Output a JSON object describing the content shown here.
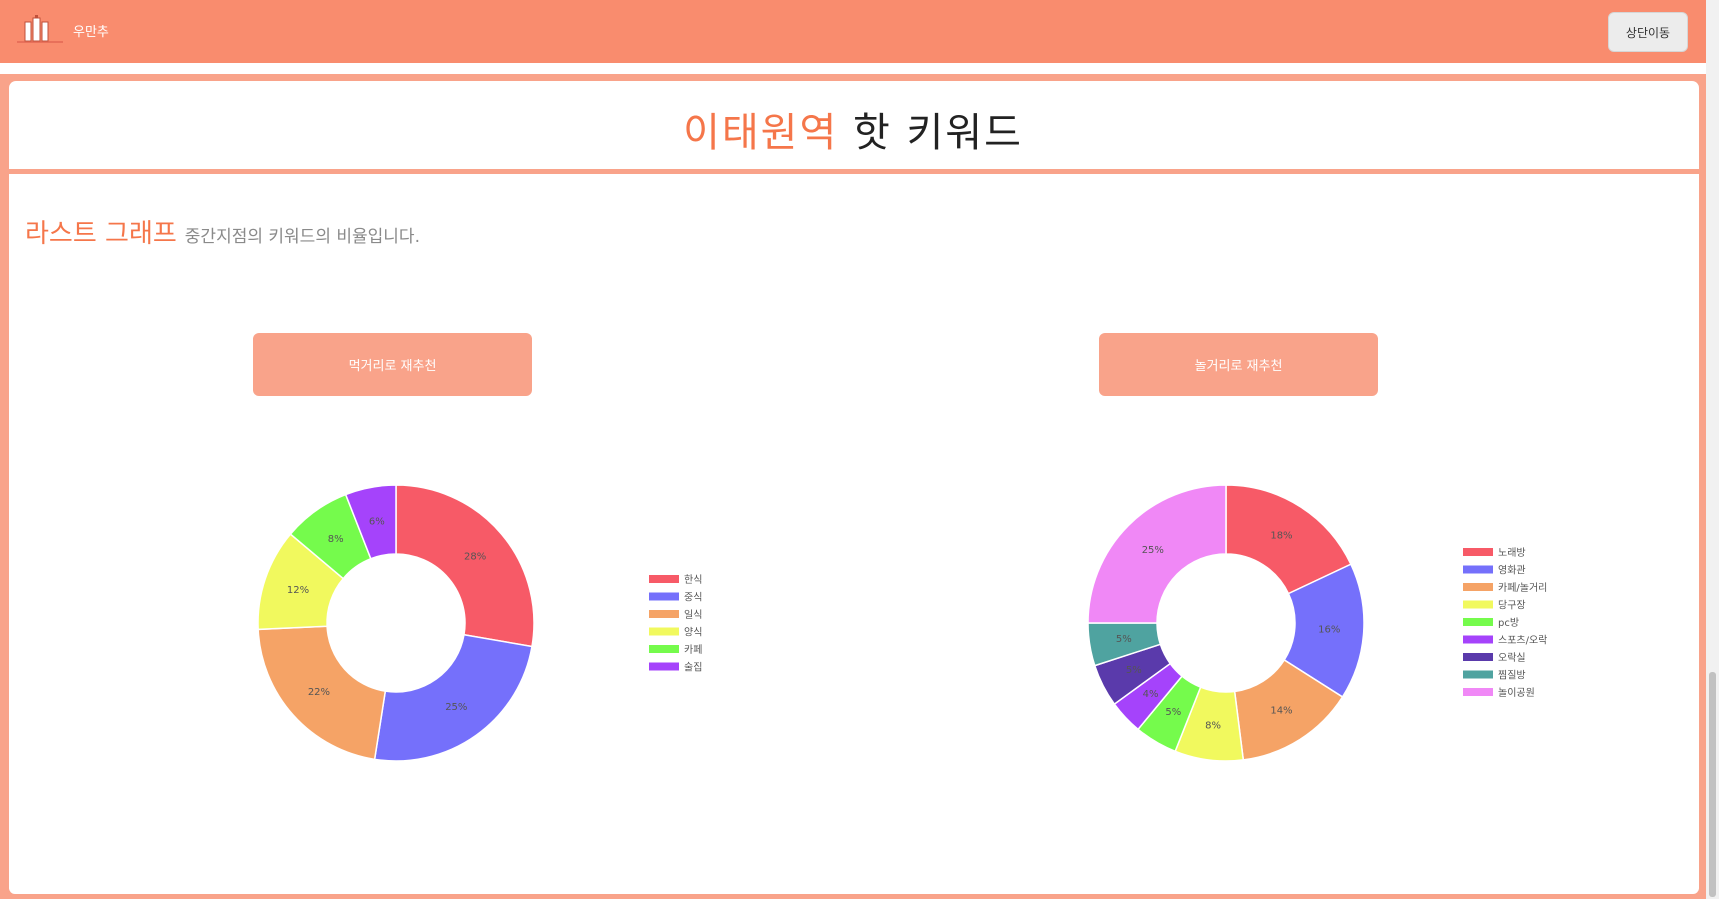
{
  "navbar": {
    "brand": "우만추",
    "top_button": "상단이동"
  },
  "title": {
    "highlight": "이태원역",
    "rest": " 핫 키워드"
  },
  "subtitle": {
    "big": "라스트 그래프",
    "small": "중간지점의 키워드의 비율입니다."
  },
  "buttons": {
    "food": "먹거리로 재추천",
    "play": "놀거리로 재추천"
  },
  "colors": {
    "accent": "#f5764a",
    "navbar": "#f98c6e",
    "frame": "#f9a38a"
  },
  "chart_data": [
    {
      "type": "pie",
      "categories": [
        "한식",
        "중식",
        "일식",
        "양식",
        "카페",
        "술집"
      ],
      "values": [
        28,
        25,
        22,
        12,
        8,
        6
      ],
      "labels": [
        "28%",
        "25%",
        "22%",
        "12%",
        "8%",
        "6%"
      ],
      "colors": [
        "#f75a67",
        "#7570fb",
        "#f5a366",
        "#f1f95e",
        "#75fb4c",
        "#a543fb"
      ],
      "legend": "right"
    },
    {
      "type": "pie",
      "categories": [
        "노래방",
        "영화관",
        "카페/놀거리",
        "당구장",
        "pc방",
        "스포츠/오락",
        "오락실",
        "찜질방",
        "놀이공원"
      ],
      "values": [
        18,
        16,
        14,
        8,
        5,
        4,
        5,
        5,
        25
      ],
      "labels": [
        "18%",
        "16%",
        "14%",
        "8%",
        "5%",
        "4%",
        "5%",
        "5%",
        "25%"
      ],
      "colors": [
        "#f75a67",
        "#7570fb",
        "#f5a366",
        "#f1f95e",
        "#75fb4c",
        "#a543fb",
        "#5a3aab",
        "#4fa3a0",
        "#f088f6"
      ],
      "legend": "right"
    }
  ]
}
